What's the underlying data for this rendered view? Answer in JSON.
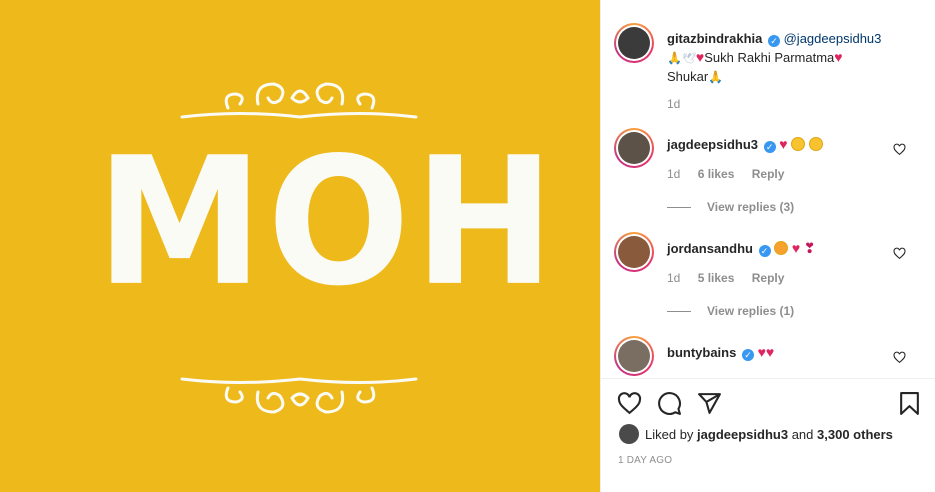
{
  "post_image": {
    "title": "MOH",
    "background_color": "#eeb91b"
  },
  "caption": {
    "username": "gitazbindrakhia",
    "mention": "@jagdeepsidhu3",
    "text": "Sukh Rakhi Parmatma",
    "text2": "Shukar",
    "time": "1d"
  },
  "comments": [
    {
      "username": "jagdeepsidhu3",
      "time": "1d",
      "likes": "6 likes",
      "reply": "Reply",
      "view_replies": "View replies (3)"
    },
    {
      "username": "jordansandhu",
      "time": "1d",
      "likes": "5 likes",
      "reply": "Reply",
      "view_replies": "View replies (1)"
    },
    {
      "username": "buntybains"
    }
  ],
  "footer": {
    "liked_by_prefix": "Liked by",
    "liked_by_user": "jagdeepsidhu3",
    "liked_by_suffix": "and",
    "liked_by_count": "3,300 others",
    "time_ago": "1 DAY AGO"
  },
  "icons": [
    "heart-icon",
    "comment-icon",
    "share-icon",
    "save-icon",
    "verified-icon"
  ]
}
